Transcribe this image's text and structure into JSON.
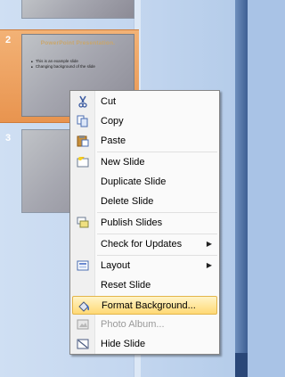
{
  "slide_panel": {
    "slides": [
      {
        "number": "2",
        "title": "PowerPoint Presentation.",
        "bullets": [
          "This is an example slide",
          "Changing background of the slide"
        ]
      },
      {
        "number": "3"
      }
    ]
  },
  "context_menu": {
    "items": [
      {
        "key": "cut",
        "label": "Cut",
        "icon": "scissors-icon"
      },
      {
        "key": "copy",
        "label": "Copy",
        "icon": "copy-icon"
      },
      {
        "key": "paste",
        "label": "Paste",
        "icon": "paste-icon"
      },
      {
        "key": "new_slide",
        "label": "New Slide",
        "icon": "new-slide-icon"
      },
      {
        "key": "duplicate_slide",
        "label": "Duplicate Slide"
      },
      {
        "key": "delete_slide",
        "label": "Delete Slide"
      },
      {
        "key": "publish_slides",
        "label": "Publish Slides",
        "icon": "publish-slides-icon"
      },
      {
        "key": "check_updates",
        "label": "Check for Updates",
        "submenu": true
      },
      {
        "key": "layout",
        "label": "Layout",
        "icon": "layout-icon",
        "submenu": true
      },
      {
        "key": "reset_slide",
        "label": "Reset Slide"
      },
      {
        "key": "format_background",
        "label": "Format Background...",
        "icon": "format-background-icon",
        "highlighted": true
      },
      {
        "key": "photo_album",
        "label": "Photo Album...",
        "icon": "photo-album-icon",
        "disabled": true
      },
      {
        "key": "hide_slide",
        "label": "Hide Slide",
        "icon": "hide-slide-icon"
      }
    ]
  },
  "colors": {
    "highlight": "#ffd975",
    "selected_slide": "#e8944f"
  }
}
